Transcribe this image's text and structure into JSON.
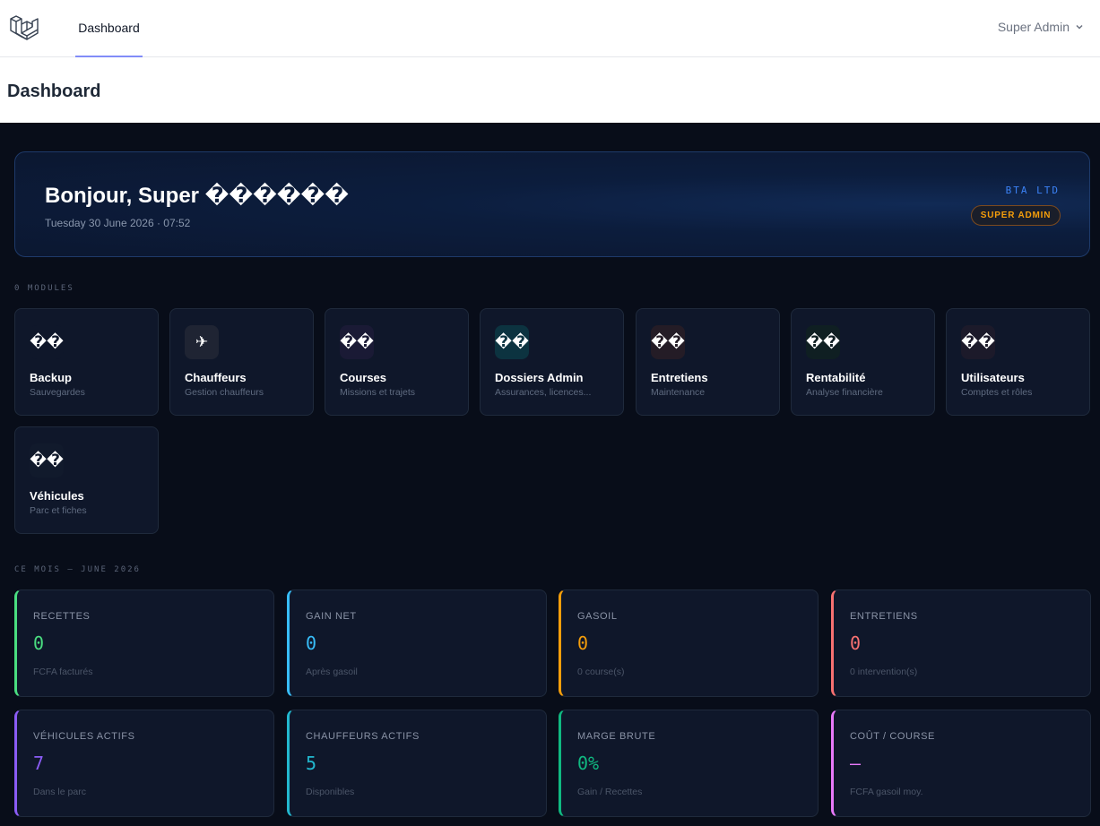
{
  "nav": {
    "logo": "laravel-logo",
    "link_dashboard": "Dashboard",
    "user_name": "Super Admin"
  },
  "header": {
    "title": "Dashboard"
  },
  "hero": {
    "greeting": "Bonjour, Super ������",
    "datetime": "Tuesday 30 June 2026 · 07:52",
    "company": "BTA LTD",
    "role_badge": "SUPER ADMIN"
  },
  "modules_label": "0 MODULES",
  "modules": [
    {
      "icon": "��",
      "title": "Backup",
      "sub": "Sauvegardes",
      "icon_bg": "#0f172a"
    },
    {
      "icon": "✈",
      "title": "Chauffeurs",
      "sub": "Gestion chauffeurs",
      "icon_bg": "#1f2433"
    },
    {
      "icon": "��",
      "title": "Courses",
      "sub": "Missions et trajets",
      "icon_bg": "#1a1a35"
    },
    {
      "icon": "��",
      "title": "Dossiers Admin",
      "sub": "Assurances, licences...",
      "icon_bg": "#0c3340"
    },
    {
      "icon": "��",
      "title": "Entretiens",
      "sub": "Maintenance",
      "icon_bg": "#241c26"
    },
    {
      "icon": "��",
      "title": "Rentabilité",
      "sub": "Analyse financière",
      "icon_bg": "#0f1f22"
    },
    {
      "icon": "��",
      "title": "Utilisateurs",
      "sub": "Comptes et rôles",
      "icon_bg": "#1c1a2a"
    },
    {
      "icon": "��",
      "title": "Véhicules",
      "sub": "Parc et fiches",
      "icon_bg": "#111a2c"
    }
  ],
  "month_label": "CE MOIS — JUNE 2026",
  "stats": [
    {
      "label": "RECETTES",
      "value": "0",
      "note": "FCFA facturés",
      "color": "#4ade80"
    },
    {
      "label": "GAIN NET",
      "value": "0",
      "note": "Après gasoil",
      "color": "#38bdf8"
    },
    {
      "label": "GASOIL",
      "value": "0",
      "note": "0 course(s)",
      "color": "#f59e0b"
    },
    {
      "label": "ENTRETIENS",
      "value": "0",
      "note": "0 intervention(s)",
      "color": "#f87171"
    },
    {
      "label": "VÉHICULES ACTIFS",
      "value": "7",
      "note": "Dans le parc",
      "color": "#8b5cf6"
    },
    {
      "label": "CHAUFFEURS ACTIFS",
      "value": "5",
      "note": "Disponibles",
      "color": "#22b8cf"
    },
    {
      "label": "MARGE BRUTE",
      "value": "0%",
      "note": "Gain / Recettes",
      "color": "#10b981"
    },
    {
      "label": "COÛT / COURSE",
      "value": "—",
      "note": "FCFA gasoil moy.",
      "color": "#e879f9"
    }
  ]
}
